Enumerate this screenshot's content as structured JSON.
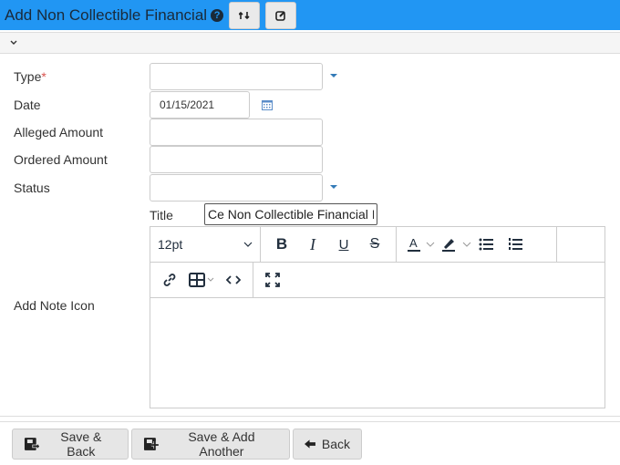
{
  "header": {
    "title": "Add Non Collectible Financial",
    "help_icon": "question-circle-icon",
    "buttons": [
      {
        "icon": "swap-icon",
        "name": "toggle-button"
      },
      {
        "icon": "edit-icon",
        "name": "edit-button"
      }
    ]
  },
  "collapse": {
    "icon": "chevron-down-icon"
  },
  "form": {
    "type": {
      "label": "Type",
      "required_mark": "*",
      "value": ""
    },
    "date": {
      "label": "Date",
      "value": "01/15/2021"
    },
    "alleged_amount": {
      "label": "Alleged Amount",
      "value": ""
    },
    "ordered_amount": {
      "label": "Ordered Amount",
      "value": ""
    },
    "status": {
      "label": "Status",
      "value": ""
    },
    "title": {
      "label": "Title",
      "value": "Ce Non Collectible Financial I"
    },
    "note": {
      "label": "Add Note Icon"
    }
  },
  "editor": {
    "font_size": "12pt",
    "toolbar": [
      "bold",
      "italic",
      "underline",
      "strikethrough",
      "text-color",
      "highlight",
      "bullet-list",
      "numbered-list",
      "link",
      "table",
      "code",
      "fullscreen"
    ]
  },
  "footer": {
    "save_back": "Save & Back",
    "save_add": "Save & Add Another",
    "back": "Back"
  }
}
